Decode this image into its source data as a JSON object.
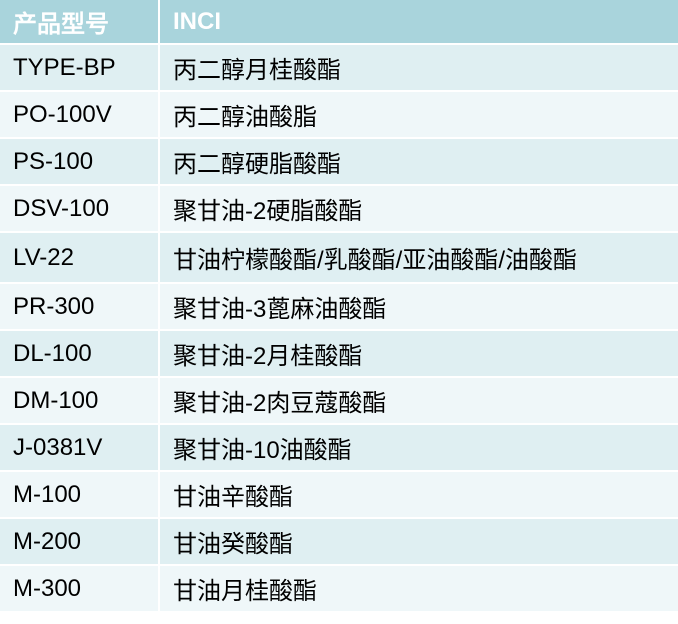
{
  "colors": {
    "header_bg": "#a9d4dc",
    "header_text": "#ffffff",
    "row_odd_bg": "#dfeff2",
    "row_even_bg": "#eff7f9"
  },
  "table": {
    "headers": [
      "产品型号",
      "INCI"
    ],
    "rows": [
      [
        "TYPE-BP",
        "丙二醇月桂酸酯"
      ],
      [
        "PO-100V",
        "丙二醇油酸脂"
      ],
      [
        "PS-100",
        "丙二醇硬脂酸酯"
      ],
      [
        "DSV-100",
        "聚甘油-2硬脂酸酯"
      ],
      [
        "LV-22",
        "甘油柠檬酸酯/乳酸酯/亚油酸酯/油酸酯"
      ],
      [
        "PR-300",
        "聚甘油-3蓖麻油酸酯"
      ],
      [
        "DL-100",
        "聚甘油-2月桂酸酯"
      ],
      [
        "DM-100",
        "聚甘油-2肉豆蔻酸酯"
      ],
      [
        "J-0381V",
        "聚甘油-10油酸酯"
      ],
      [
        "M-100",
        "甘油辛酸酯"
      ],
      [
        "M-200",
        "甘油癸酸酯"
      ],
      [
        "M-300",
        "甘油月桂酸酯"
      ]
    ]
  }
}
